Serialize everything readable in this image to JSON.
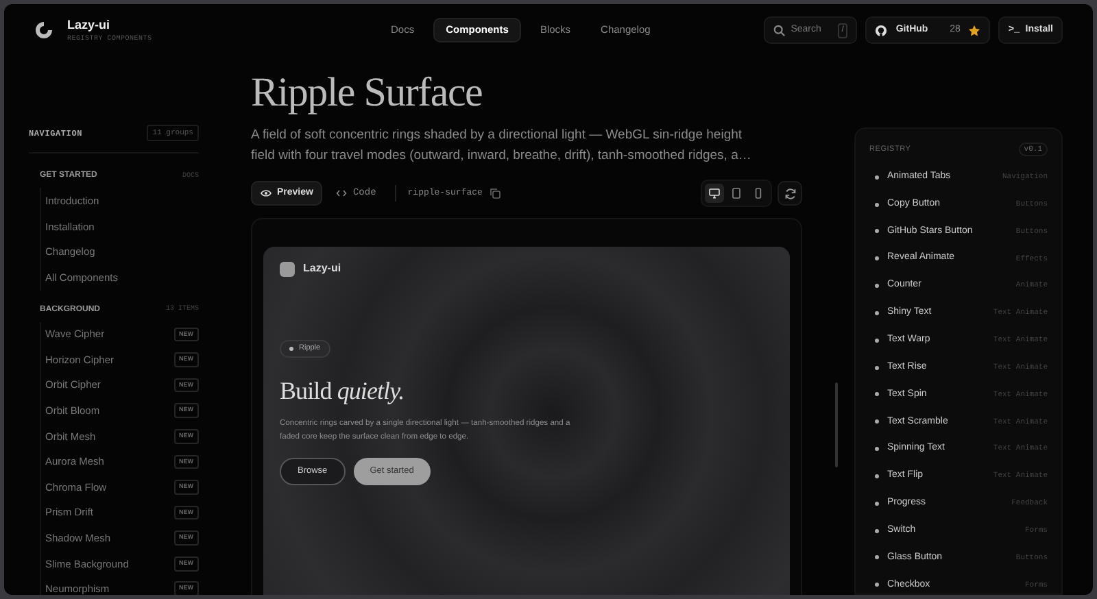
{
  "brand": {
    "name": "Lazy-ui",
    "subtitle": "REGISTRY COMPONENTS"
  },
  "nav": [
    {
      "label": "Docs",
      "selected": false
    },
    {
      "label": "Components",
      "selected": true
    },
    {
      "label": "Blocks",
      "selected": false
    },
    {
      "label": "Changelog",
      "selected": false
    }
  ],
  "search": {
    "placeholder": "Search",
    "shortcut": "/"
  },
  "github": {
    "label": "GitHub",
    "count": "28"
  },
  "install": {
    "icon_text": ">_",
    "label": "Install"
  },
  "sidebar": {
    "title": "NAVIGATION",
    "count": "11 groups",
    "groups": [
      {
        "title": "GET STARTED",
        "count": "DOCS",
        "items": [
          {
            "label": "Introduction"
          },
          {
            "label": "Installation"
          },
          {
            "label": "Changelog"
          },
          {
            "label": "All Components"
          }
        ]
      },
      {
        "title": "BACKGROUND",
        "count": "13 ITEMS",
        "items": [
          {
            "label": "Wave Cipher",
            "badge": "NEW"
          },
          {
            "label": "Horizon Cipher",
            "badge": "NEW"
          },
          {
            "label": "Orbit Cipher",
            "badge": "NEW"
          },
          {
            "label": "Orbit Bloom",
            "badge": "NEW"
          },
          {
            "label": "Orbit Mesh",
            "badge": "NEW"
          },
          {
            "label": "Aurora Mesh",
            "badge": "NEW"
          },
          {
            "label": "Chroma Flow",
            "badge": "NEW"
          },
          {
            "label": "Prism Drift",
            "badge": "NEW"
          },
          {
            "label": "Shadow Mesh",
            "badge": "NEW"
          },
          {
            "label": "Slime Background",
            "badge": "NEW"
          },
          {
            "label": "Neumorphism",
            "badge": "NEW"
          }
        ]
      }
    ]
  },
  "page": {
    "title": "Ripple Surface",
    "description": "A field of soft concentric rings shaded by a directional light — WebGL sin-ridge height field with four travel modes (outward, inward, breathe, drift), tanh-smoothed ridges, a…",
    "view_tabs": [
      {
        "label": "Preview",
        "selected": true
      },
      {
        "label": "Code",
        "selected": false
      }
    ],
    "slug": "ripple-surface",
    "devices": [
      {
        "kind": "desktop",
        "selected": true
      },
      {
        "kind": "tablet",
        "selected": false
      },
      {
        "kind": "phone",
        "selected": false
      }
    ]
  },
  "preview": {
    "brand": "Lazy-ui",
    "pill": "Ripple",
    "headline": "Build *quietly.*",
    "body": "Concentric rings carved by a single directional light — tanh-smoothed ridges and a faded core keep the surface clean from edge to edge.",
    "buttons": [
      {
        "label": "Browse",
        "kind": "outline"
      },
      {
        "label": "Get started",
        "kind": "solid"
      }
    ]
  },
  "registry": {
    "title": "REGISTRY",
    "version": "v0.1",
    "items": [
      {
        "name": "Animated Tabs",
        "category": "Navigation"
      },
      {
        "name": "Copy Button",
        "category": "Buttons"
      },
      {
        "name": "GitHub Stars Button",
        "category": "Buttons"
      },
      {
        "name": "Reveal Animate",
        "category": "Effects"
      },
      {
        "name": "Counter",
        "category": "Animate"
      },
      {
        "name": "Shiny Text",
        "category": "Text Animate"
      },
      {
        "name": "Text Warp",
        "category": "Text Animate"
      },
      {
        "name": "Text Rise",
        "category": "Text Animate"
      },
      {
        "name": "Text Spin",
        "category": "Text Animate"
      },
      {
        "name": "Text Scramble",
        "category": "Text Animate"
      },
      {
        "name": "Spinning Text",
        "category": "Text Animate"
      },
      {
        "name": "Text Flip",
        "category": "Text Animate"
      },
      {
        "name": "Progress",
        "category": "Feedback"
      },
      {
        "name": "Switch",
        "category": "Forms"
      },
      {
        "name": "Glass Button",
        "category": "Buttons"
      },
      {
        "name": "Checkbox",
        "category": "Forms"
      }
    ]
  }
}
